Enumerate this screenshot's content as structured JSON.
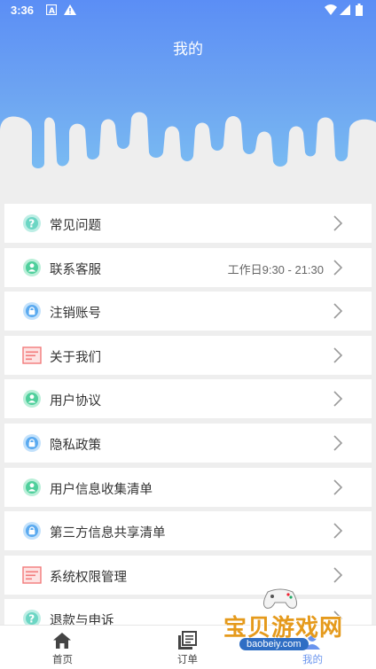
{
  "status_bar": {
    "time": "3:36"
  },
  "header": {
    "title": "我的"
  },
  "menu": [
    {
      "label": "常见问题",
      "icon": "question-icon",
      "color": "#6cd6c4",
      "extra": ""
    },
    {
      "label": "联系客服",
      "icon": "person-icon",
      "color": "#4fcf9c",
      "extra": "工作日9:30 - 21:30"
    },
    {
      "label": "注销账号",
      "icon": "lock-icon",
      "color": "#5aaaf0",
      "extra": ""
    },
    {
      "label": "关于我们",
      "icon": "document-icon",
      "color": "#f27b7b",
      "extra": ""
    },
    {
      "label": "用户协议",
      "icon": "person-icon",
      "color": "#4fcf9c",
      "extra": ""
    },
    {
      "label": "隐私政策",
      "icon": "lock-icon",
      "color": "#5aaaf0",
      "extra": ""
    },
    {
      "label": "用户信息收集清单",
      "icon": "person-icon",
      "color": "#4fcf9c",
      "extra": ""
    },
    {
      "label": "第三方信息共享清单",
      "icon": "lock-icon",
      "color": "#5aaaf0",
      "extra": ""
    },
    {
      "label": "系统权限管理",
      "icon": "document-icon",
      "color": "#f27b7b",
      "extra": ""
    },
    {
      "label": "退款与申诉",
      "icon": "question-icon",
      "color": "#6cd6c4",
      "extra": ""
    }
  ],
  "tabbar": [
    {
      "label": "首页",
      "icon": "home-icon"
    },
    {
      "label": "订单",
      "icon": "orders-icon"
    },
    {
      "label": "我的",
      "icon": "profile-icon",
      "active": true
    }
  ],
  "watermark": {
    "text": "宝贝游戏网",
    "url": "baobeiy.com"
  },
  "colors": {
    "header_top": "#5b8ef5",
    "header_bottom": "#7fc6f3",
    "accent": "#6b95ee",
    "background": "#eeeeee"
  }
}
